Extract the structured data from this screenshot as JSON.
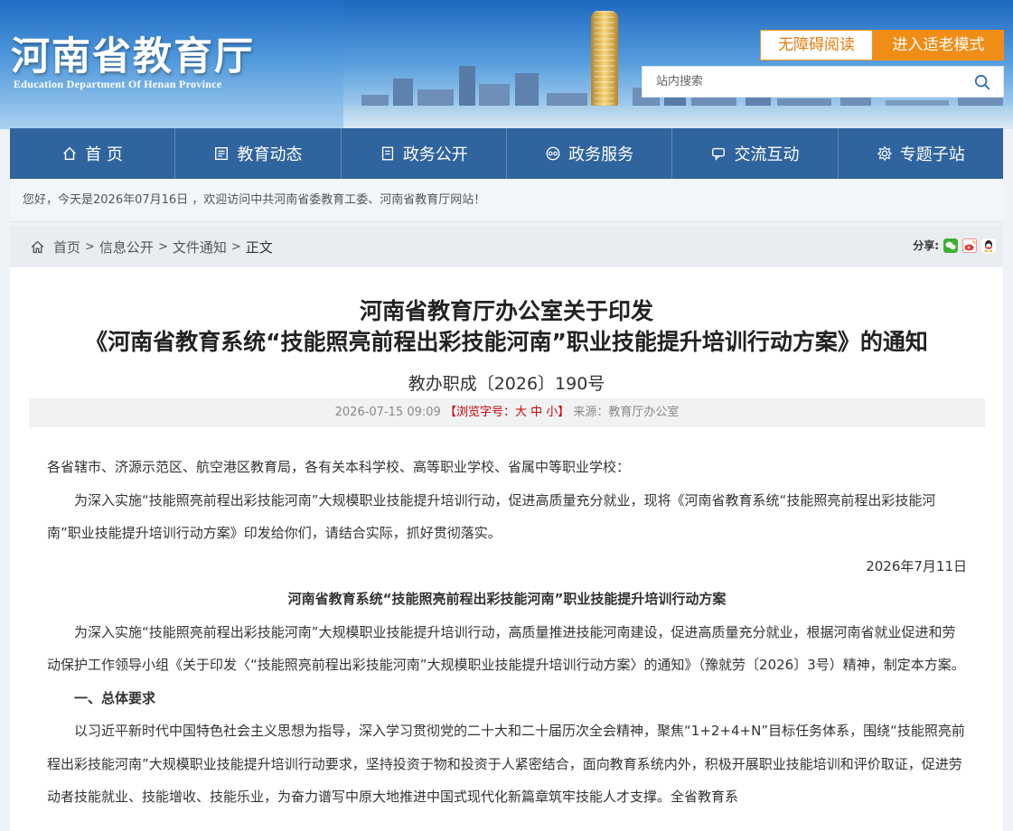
{
  "header": {
    "logo_cn": "河南省教育厅",
    "logo_en": "Education Department Of Henan Province",
    "accessible_btn": "无障碍阅读",
    "elder_mode_btn": "进入适老模式",
    "search_placeholder": "站内搜索"
  },
  "nav": [
    {
      "label": "首 页",
      "icon": "home-icon"
    },
    {
      "label": "教育动态",
      "icon": "news-icon"
    },
    {
      "label": "政务公开",
      "icon": "doc-icon"
    },
    {
      "label": "政务服务",
      "icon": "service-icon"
    },
    {
      "label": "交流互动",
      "icon": "chat-icon"
    },
    {
      "label": "专题子站",
      "icon": "site-icon"
    }
  ],
  "welcome": "您好，今天是2026年07月16日 ，欢迎访问中共河南省委教育工委、河南省教育厅网站！",
  "breadcrumb": {
    "home": "首页",
    "c1": "信息公开",
    "c2": "文件通知",
    "c3": "正文",
    "sep": ">"
  },
  "share": {
    "label": "分享:",
    "icons": [
      "wechat-icon",
      "weibo-icon",
      "qq-icon"
    ],
    "colors": {
      "wechat": "#3cb034",
      "weibo": "#e6322a",
      "qq": "#1a8fd8"
    }
  },
  "article": {
    "title1": "河南省教育厅办公室关于印发",
    "title2": "《河南省教育系统“技能照亮前程出彩技能河南”职业技能提升培训行动方案》的通知",
    "doc_no": "教办职成〔2026〕190号",
    "date": "2026-07-15 09:09",
    "font_label": "【浏览字号：大 中 小】",
    "source": "来源：教育厅办公室",
    "paragraphs": [
      {
        "cls": "",
        "text": "各省辖市、济源示范区、航空港区教育局，各有关本科学校、高等职业学校、省属中等职业学校："
      },
      {
        "cls": "ind",
        "text": "为深入实施“技能照亮前程出彩技能河南”大规模职业技能提升培训行动，促进高质量充分就业，现将《河南省教育系统“技能照亮前程出彩技能河南”职业技能提升培训行动方案》印发给你们，请结合实际，抓好贯彻落实。"
      },
      {
        "cls": "right",
        "text": "2026年7月11日"
      },
      {
        "cls": "ctr",
        "text": "河南省教育系统“技能照亮前程出彩技能河南”职业技能提升培训行动方案"
      },
      {
        "cls": "ind",
        "text": "为深入实施“技能照亮前程出彩技能河南”大规模职业技能提升培训行动，高质量推进技能河南建设，促进高质量充分就业，根据河南省就业促进和劳动保护工作领导小组《关于印发〈“技能照亮前程出彩技能河南”大规模职业技能提升培训行动方案〉的通知》（豫就劳〔2026〕3号）精神，制定本方案。"
      },
      {
        "cls": "h",
        "text": "一、总体要求"
      },
      {
        "cls": "ind",
        "text": "以习近平新时代中国特色社会主义思想为指导，深入学习贯彻党的二十大和二十届历次全会精神，聚焦“1+2+4+N”目标任务体系，围绕“技能照亮前程出彩技能河南”大规模职业技能提升培训行动要求，坚持投资于物和投资于人紧密结合，面向教育系统内外，积极开展职业技能培训和评价取证，促进劳动者技能就业、技能增收、技能乐业，为奋力谱写中原大地推进中国式现代化新篇章筑牢技能人才支撑。全省教育系"
      }
    ]
  }
}
